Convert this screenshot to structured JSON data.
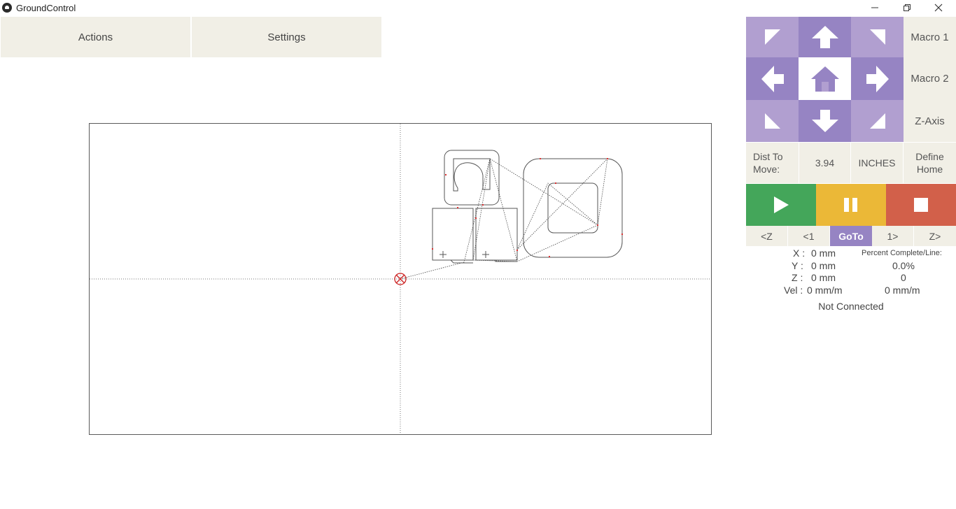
{
  "window": {
    "title": "GroundControl"
  },
  "menu": {
    "actions": "Actions",
    "settings": "Settings"
  },
  "jog": {
    "macro1": "Macro 1",
    "macro2": "Macro 2",
    "zaxis": "Z-Axis",
    "dist_label": "Dist To Move:",
    "dist_value": "3.94",
    "units": "INCHES",
    "define_home": "Define Home"
  },
  "steps": {
    "z_back": "<Z",
    "line_back": "<1",
    "goto": "GoTo",
    "line_fwd": "1>",
    "z_fwd": "Z>"
  },
  "readout": {
    "x_label": "X :",
    "x_value": "0 mm",
    "y_label": "Y :",
    "y_value": "0 mm",
    "z_label": "Z :",
    "z_value": "0 mm",
    "vel_label": "Vel :",
    "vel_value": "0 mm/m",
    "percent_label": "Percent Complete/Line:",
    "percent_value": "0.0%",
    "line_value": "0",
    "feed_value": "0 mm/m"
  },
  "status": "Not Connected",
  "colors": {
    "jog_light": "#b19fd0",
    "jog_dark": "#9684c3",
    "play": "#44a65a",
    "pause": "#ebb837",
    "stop": "#d2604a",
    "neutral": "#f1efe6",
    "origin_marker": "#cc2222"
  },
  "icons": {
    "jog_up_left": "arrow-up-left-icon",
    "jog_up": "arrow-up-icon",
    "jog_up_right": "arrow-up-right-icon",
    "jog_left": "arrow-left-icon",
    "home": "home-icon",
    "jog_right": "arrow-right-icon",
    "jog_down_left": "arrow-down-left-icon",
    "jog_down": "arrow-down-icon",
    "jog_down_right": "arrow-down-right-icon",
    "play": "play-icon",
    "pause": "pause-icon",
    "stop": "stop-icon"
  }
}
